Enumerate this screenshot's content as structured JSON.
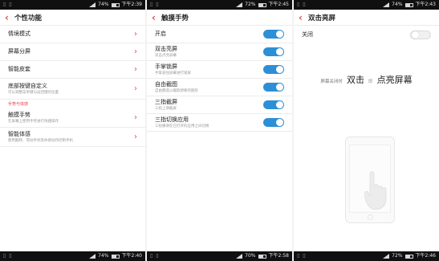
{
  "status": {
    "p1_top": {
      "battery": "74%",
      "time": "下午2:39"
    },
    "p2_top": {
      "battery": "72%",
      "time": "下午2:45"
    },
    "p3_top": {
      "battery": "74%",
      "time": "下午2:43"
    },
    "p1_bottom": {
      "battery": "74%",
      "time": "下午2:40"
    },
    "p2_bottom": {
      "battery": "70%",
      "time": "下午2:58"
    },
    "p3_bottom": {
      "battery": "72%",
      "time": "下午2:46"
    }
  },
  "screen1": {
    "title": "个性功能",
    "items": [
      {
        "label": "情境模式",
        "sub": ""
      },
      {
        "label": "屏幕分屏",
        "sub": ""
      },
      {
        "label": "智能皮套",
        "sub": ""
      },
      {
        "label": "底部按键自定义",
        "sub": "可以调整菜单键与返回键的位置"
      }
    ],
    "section_label": "手势与体感",
    "gesture_items": [
      {
        "label": "触摸手势",
        "sub": "在屏幕上使用手势进行快捷操作"
      },
      {
        "label": "智能体感",
        "sub": "使用翻转、晃动手机等体感动作控制手机"
      }
    ]
  },
  "screen2": {
    "title": "触摸手势",
    "master_label": "开启",
    "items": [
      {
        "label": "双击亮屏",
        "sub": "双击点亮屏幕"
      },
      {
        "label": "手掌锁屏",
        "sub": "手掌盖住屏幕进行锁屏"
      },
      {
        "label": "自由截图",
        "sub": "自由圈选以截取想要的图形"
      },
      {
        "label": "三指截屏",
        "sub": "三指上滑截屏"
      },
      {
        "label": "三指切换应用",
        "sub": "三指横滑在已打开的应用之间切换"
      }
    ]
  },
  "screen3": {
    "title": "双击亮屏",
    "off_label": "关闭",
    "hint_pre": "屏幕关闭时",
    "hint_big1": "双击",
    "hint_mid": "即",
    "hint_big2": "点亮屏幕"
  },
  "colors": {
    "accent": "#e6454a",
    "toggle_on": "#2d8fd6"
  },
  "icons": {
    "back": "chevron-left-icon",
    "forward": "chevron-right-icon",
    "hand": "hand-pointer-icon"
  }
}
